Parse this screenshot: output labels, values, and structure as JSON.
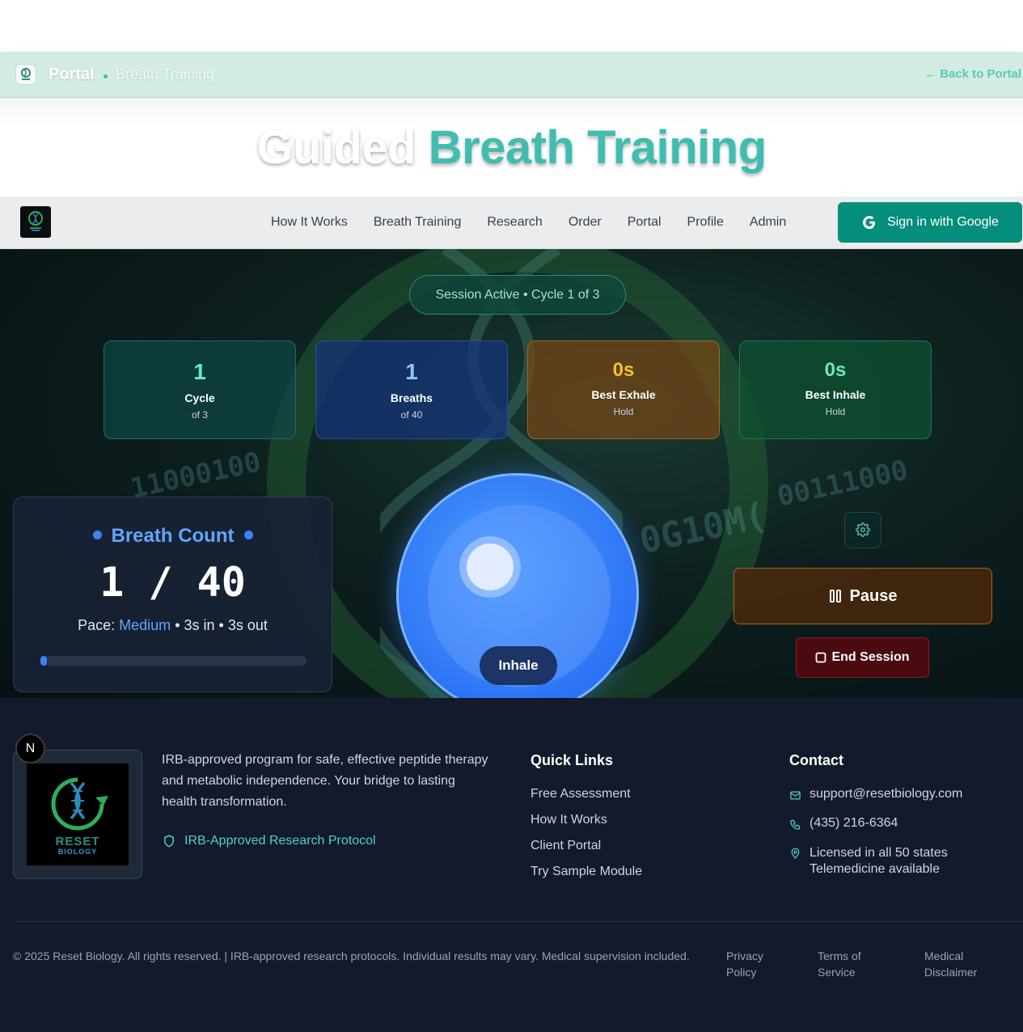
{
  "portal_bar": {
    "title": "Portal",
    "subtitle": "Breath Training",
    "back_link": "← Back to Portal"
  },
  "hero": {
    "title_part1": "Guided",
    "title_part2": "Breath Training"
  },
  "nav": {
    "links": [
      "How It Works",
      "Breath Training",
      "Research",
      "Order",
      "Portal",
      "Profile",
      "Admin"
    ],
    "signin_label": "Sign in with Google"
  },
  "session": {
    "status": "Session Active • Cycle 1 of 3",
    "stats": [
      {
        "value": "1",
        "label": "Cycle",
        "sub": "of 3"
      },
      {
        "value": "1",
        "label": "Breaths",
        "sub": "of 40"
      },
      {
        "value": "0s",
        "label": "Best Exhale",
        "sub": "Hold"
      },
      {
        "value": "0s",
        "label": "Best Inhale",
        "sub": "Hold"
      }
    ],
    "breath_count": {
      "title": "Breath Count",
      "count": "1 / 40",
      "pace_prefix": "Pace:",
      "pace_value": "Medium",
      "pace_detail": "• 3s in • 3s out",
      "progress_fraction": 0.025
    },
    "phase_label": "Inhale",
    "pause_label": "Pause",
    "end_label": "End Session"
  },
  "footer": {
    "badge_letter": "N",
    "logo_text": "RESET",
    "logo_subtext": "BIOLOGY",
    "description": "IRB-approved program for safe, effective peptide therapy and metabolic independence. Your bridge to lasting health transformation.",
    "irb_label": "IRB-Approved Research Protocol",
    "quick_links_title": "Quick Links",
    "quick_links": [
      "Free Assessment",
      "How It Works",
      "Client Portal",
      "Try Sample Module"
    ],
    "contact_title": "Contact",
    "email": "support@resetbiology.com",
    "phone": "(435) 216-6364",
    "license_line1": "Licensed in all 50 states",
    "license_line2": "Telemedicine available",
    "copyright": "© 2025 Reset Biology. All rights reserved. | IRB-approved research protocols. Individual results may vary. Medical supervision included.",
    "legal": [
      "Privacy Policy",
      "Terms of Service",
      "Medical Disclaimer"
    ]
  },
  "colors": {
    "teal_accent": "#40bdb0",
    "signin_bg": "#058e7b",
    "breath_blue": "#2f7bff",
    "pause_border": "#9a6a20",
    "end_bg": "#4a0b10"
  }
}
